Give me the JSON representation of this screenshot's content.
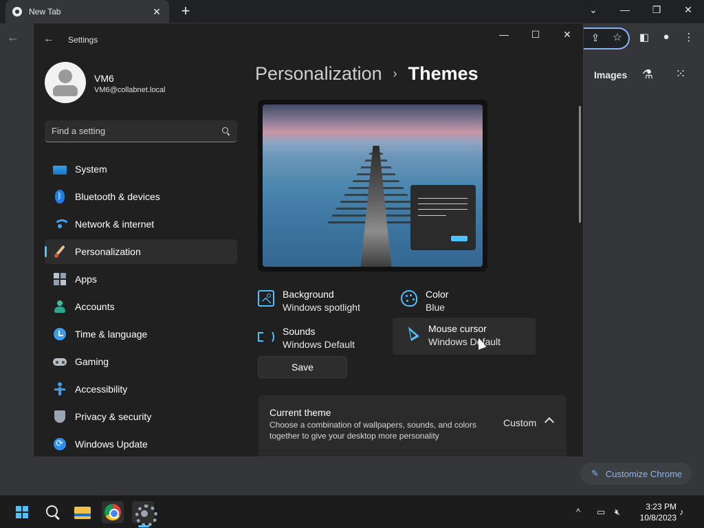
{
  "chrome": {
    "tab_title": "New Tab",
    "tab_close": "✕",
    "new_tab": "+",
    "back": "←",
    "images_link": "Images",
    "customize_label": "Customize Chrome",
    "window_controls": {
      "chevron": "⌄",
      "minimize": "—",
      "restore": "❐",
      "close": "✕"
    }
  },
  "settings": {
    "app_title": "Settings",
    "back": "←",
    "window_controls": {
      "minimize": "—",
      "maximize": "☐",
      "close": "✕"
    },
    "user": {
      "name": "VM6",
      "email": "VM6@collabnet.local"
    },
    "search": {
      "placeholder": "Find a setting"
    },
    "nav": [
      {
        "label": "System",
        "icon": "monitor-icon"
      },
      {
        "label": "Bluetooth & devices",
        "icon": "bluetooth-icon"
      },
      {
        "label": "Network & internet",
        "icon": "wifi-icon"
      },
      {
        "label": "Personalization",
        "icon": "brush-icon",
        "active": true
      },
      {
        "label": "Apps",
        "icon": "apps-icon"
      },
      {
        "label": "Accounts",
        "icon": "person-icon"
      },
      {
        "label": "Time & language",
        "icon": "globe-clock-icon"
      },
      {
        "label": "Gaming",
        "icon": "gamepad-icon"
      },
      {
        "label": "Accessibility",
        "icon": "accessibility-icon"
      },
      {
        "label": "Privacy & security",
        "icon": "shield-icon"
      },
      {
        "label": "Windows Update",
        "icon": "update-icon"
      }
    ],
    "breadcrumb": {
      "parent": "Personalization",
      "separator": "›",
      "current": "Themes"
    },
    "options": {
      "background": {
        "title": "Background",
        "value": "Windows spotlight"
      },
      "color": {
        "title": "Color",
        "value": "Blue"
      },
      "sounds": {
        "title": "Sounds",
        "value": "Windows Default"
      },
      "cursor": {
        "title": "Mouse cursor",
        "value": "Windows Default"
      }
    },
    "save_label": "Save",
    "current_theme": {
      "title": "Current theme",
      "description": "Choose a combination of wallpapers, sounds, and colors together to give your desktop more personality",
      "value": "Custom"
    }
  },
  "taskbar": {
    "clock_time": "3:23 PM",
    "clock_date": "10/8/2023",
    "tray_chevron": "^"
  },
  "colors": {
    "accent": "#4cc2ff",
    "window_bg": "#202020",
    "card_bg": "#2b2b2b"
  }
}
